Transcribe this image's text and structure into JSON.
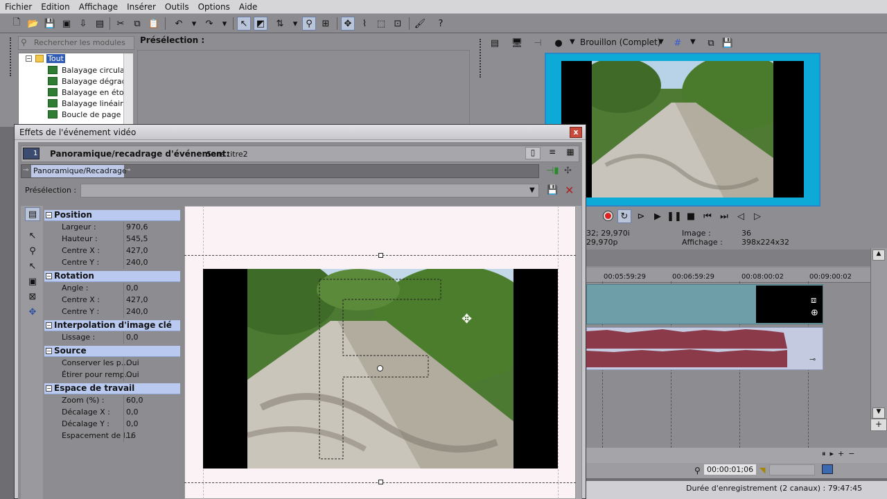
{
  "menubar": {
    "items": [
      "Fichier",
      "Edition",
      "Affichage",
      "Insérer",
      "Outils",
      "Options",
      "Aide"
    ]
  },
  "explorer": {
    "search_placeholder": "Rechercher les modules",
    "tree_root": "Tout",
    "tree_items": [
      "Balayage circulaire",
      "Balayage dégradé",
      "Balayage en étoile",
      "Balayage linéaire",
      "Boucle de page sc"
    ]
  },
  "preset_top_label": "Présélection :",
  "preview": {
    "quality": "Brouillon (Complet)",
    "info_left_1": "32; 29,970i",
    "info_left_2": "29,970p",
    "info_image_label": "Image :",
    "info_image_value": "36",
    "info_display_label": "Affichage :",
    "info_display_value": "398x224x32"
  },
  "timeline": {
    "times": [
      "00:05:59:29",
      "00:06:59:29",
      "00:08:00:02",
      "00:09:00:02"
    ],
    "cursor_time": "00:00:01;06",
    "status": "Durée d'enregistrement (2 canaux) : 79:47:45"
  },
  "dialog": {
    "title": "Effets de l'événement vidéo",
    "chain_number": "1",
    "chain_title": "Panoramique/recadrage d'événement:",
    "chain_subtitle": "Sans titre2",
    "plugin_name": "Panoramique/Recadrage",
    "preset_label": "Présélection :",
    "sections": [
      {
        "title": "Position",
        "rows": [
          [
            "Largeur :",
            "970,6"
          ],
          [
            "Hauteur :",
            "545,5"
          ],
          [
            "Centre X :",
            "427,0"
          ],
          [
            "Centre Y :",
            "240,0"
          ]
        ]
      },
      {
        "title": "Rotation",
        "rows": [
          [
            "Angle :",
            "0,0"
          ],
          [
            "Centre X :",
            "427,0"
          ],
          [
            "Centre Y :",
            "240,0"
          ]
        ]
      },
      {
        "title": "Interpolation d'image clé",
        "rows": [
          [
            "Lissage :",
            "0,0"
          ]
        ]
      },
      {
        "title": "Source",
        "rows": [
          [
            "Conserver les p...",
            "Oui"
          ],
          [
            "Étirer pour remp...",
            "Oui"
          ]
        ]
      },
      {
        "title": "Espace de travail",
        "rows": [
          [
            "Zoom (%) :",
            "60,0"
          ],
          [
            "Décalage X :",
            "0,0"
          ],
          [
            "Décalage Y :",
            "0,0"
          ],
          [
            "Espacement de l...",
            "16"
          ]
        ]
      }
    ]
  },
  "colors": {
    "accent": "#0da9d7",
    "section_header": "#b9c9ef",
    "audio_wave": "#8b3a4a"
  }
}
